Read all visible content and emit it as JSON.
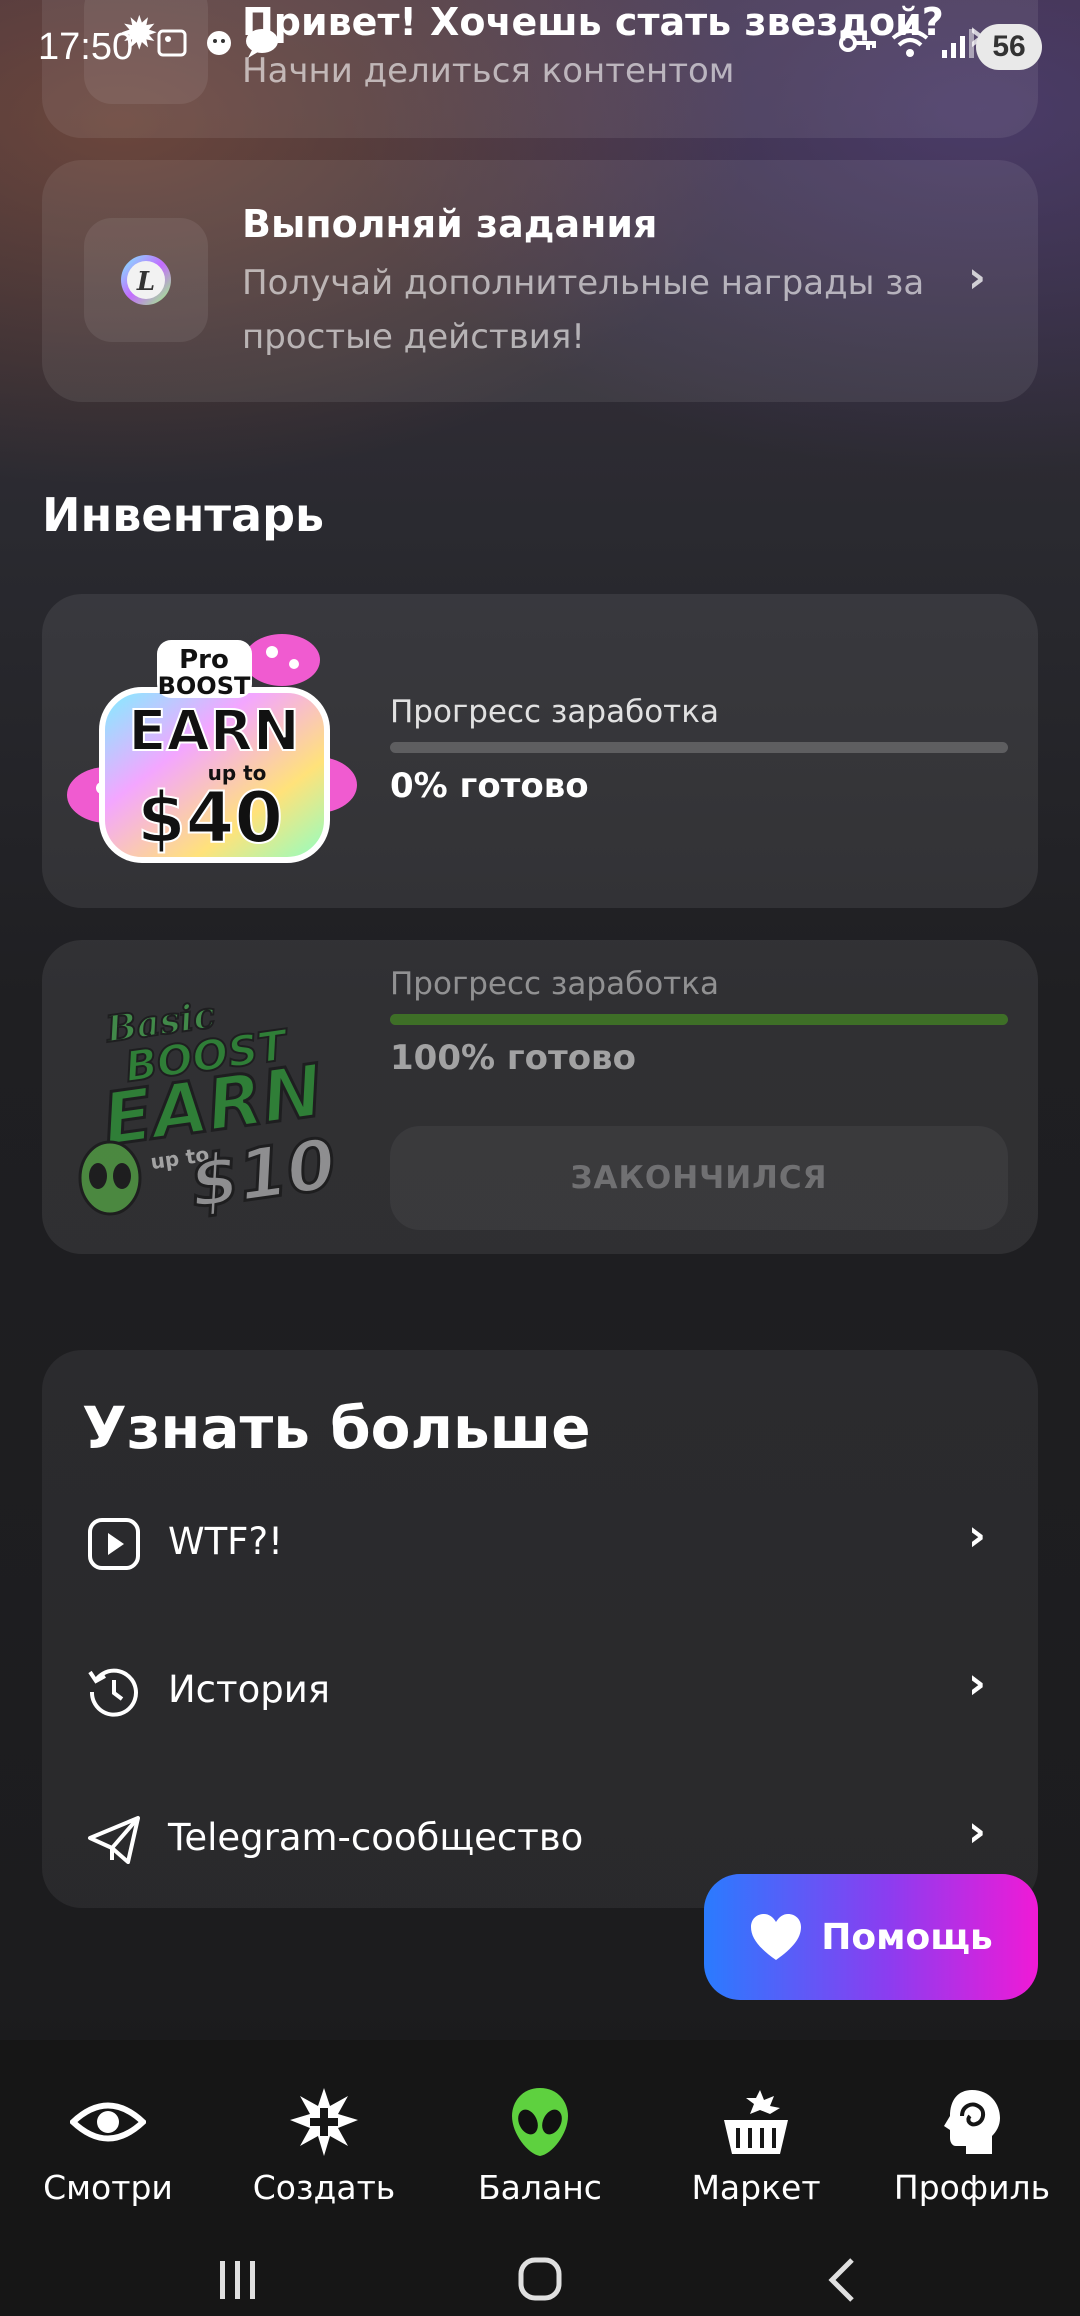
{
  "status_bar": {
    "time": "17:50",
    "badge": "56"
  },
  "top_cards": [
    {
      "title": "Привет! Хочешь стать звездой?",
      "subtitle": "Начни делиться контентом"
    },
    {
      "title": "Выполняй задания",
      "subtitle": "Получай дополнительные награды за простые действия!"
    }
  ],
  "inventory": {
    "title": "Инвентарь",
    "items": [
      {
        "image_text": [
          "Pro",
          "BOOST",
          "EARN",
          "up to",
          "$40"
        ],
        "progress_label": "Прогресс заработка",
        "progress": 0,
        "progress_text": "0% готово"
      },
      {
        "image_text": [
          "Basic",
          "BOOST",
          "EARN",
          "up to",
          "$10"
        ],
        "progress_label": "Прогресс заработка",
        "progress": 1.0,
        "progress_text": "100% готово",
        "button_label": "ЗАКОНЧИЛСЯ"
      }
    ]
  },
  "learn_more": {
    "title": "Узнать больше",
    "items": [
      {
        "label": "WTF?!",
        "icon": "play-icon"
      },
      {
        "label": "История",
        "icon": "history-icon"
      },
      {
        "label": "Telegram-сообщество",
        "icon": "telegram-icon"
      }
    ]
  },
  "help_button": {
    "label": "Помощь",
    "icon": "heart-icon"
  },
  "bottom_nav": [
    {
      "label": "Смотри",
      "icon": "eye-icon"
    },
    {
      "label": "Создать",
      "icon": "create-icon"
    },
    {
      "label": "Баланс",
      "icon": "alien-icon"
    },
    {
      "label": "Маркет",
      "icon": "basket-icon"
    },
    {
      "label": "Профиль",
      "icon": "profile-icon"
    }
  ],
  "colors": {
    "progress_green": "#4aa31f",
    "help_gradient_start": "#2a7bff",
    "help_gradient_end": "#f01ad6"
  }
}
